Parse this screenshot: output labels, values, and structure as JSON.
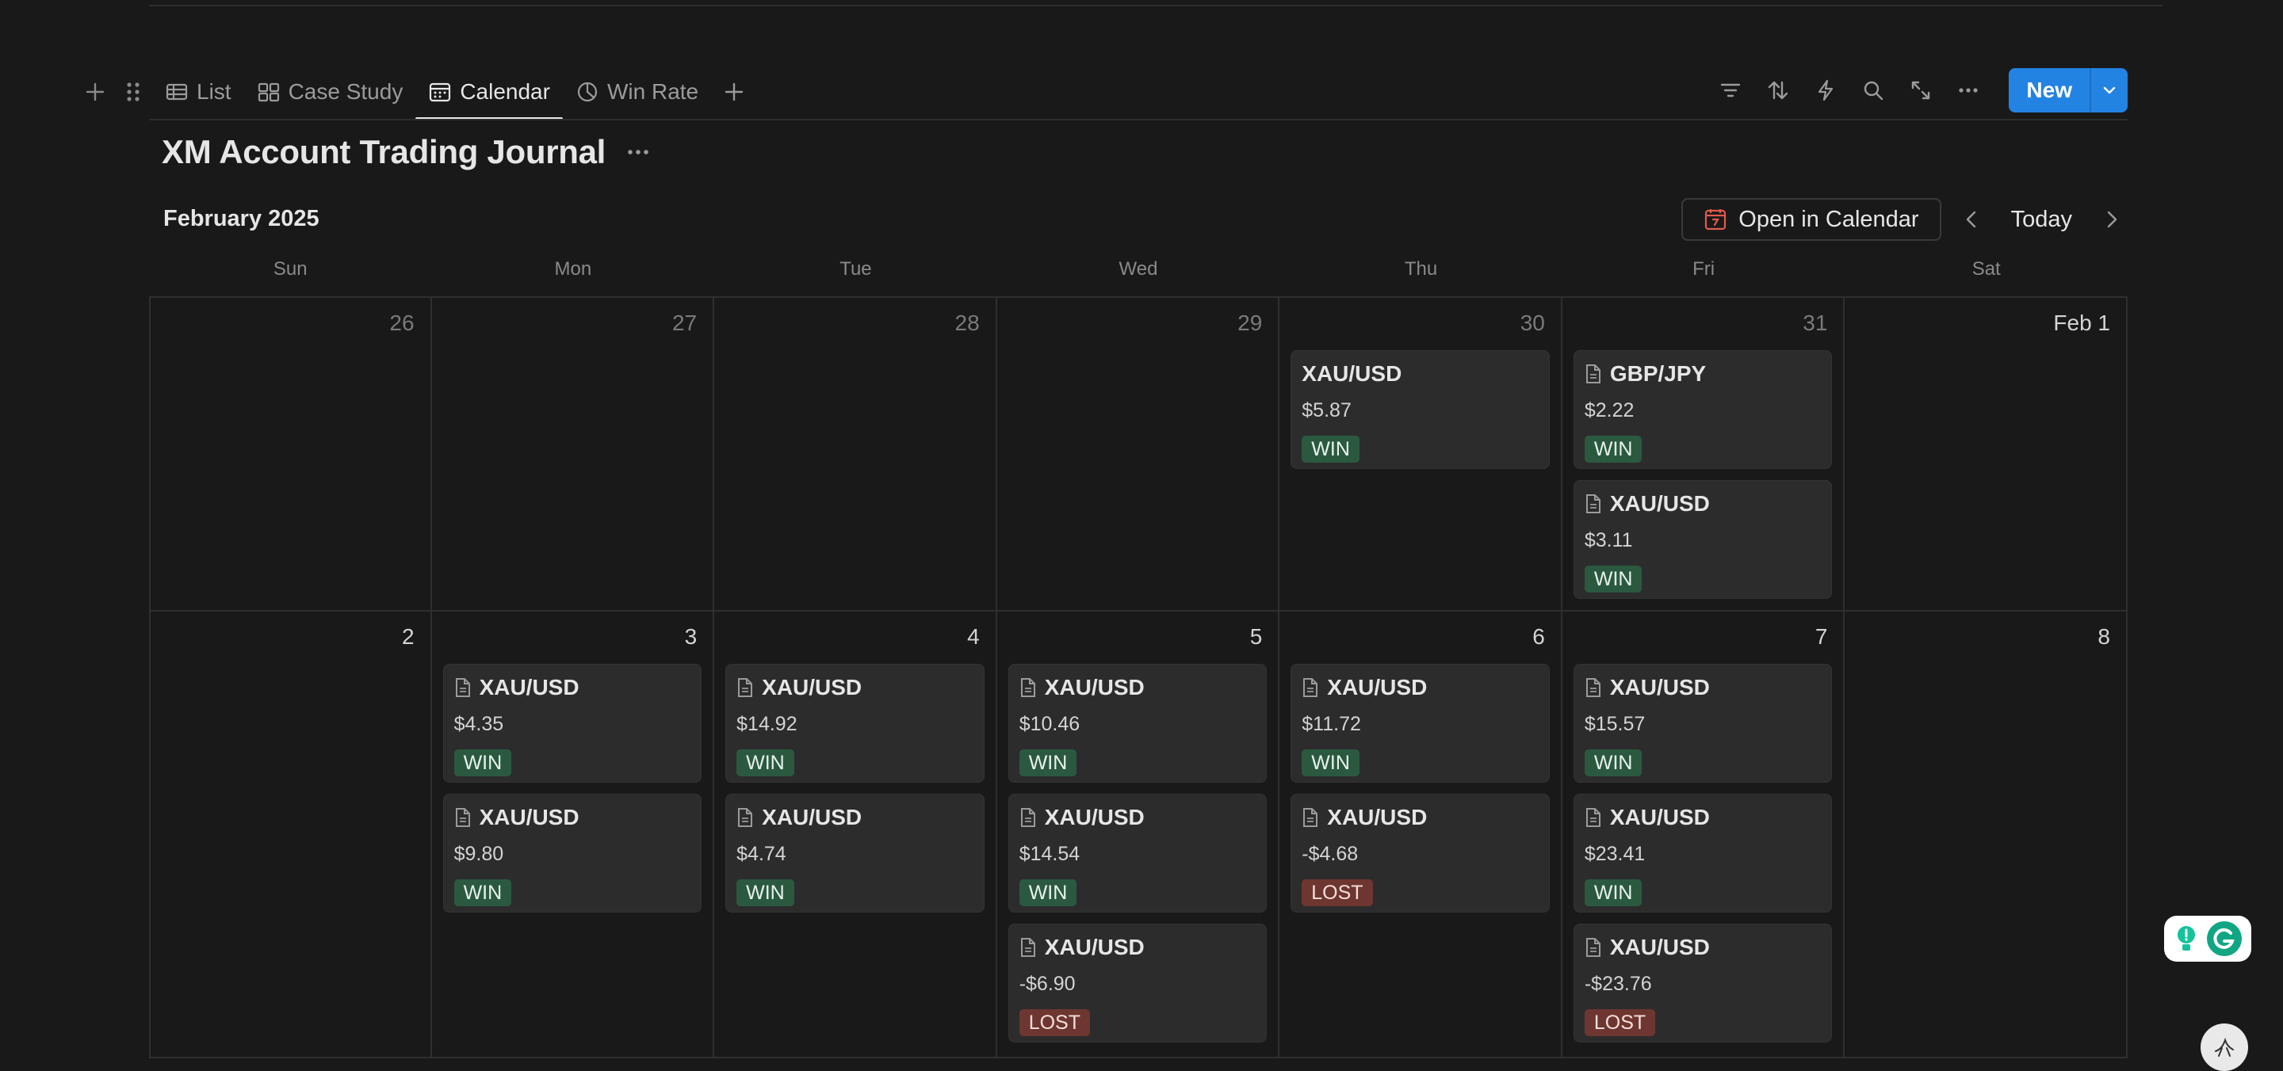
{
  "tabs": [
    {
      "label": "List",
      "icon": "table-icon",
      "active": false
    },
    {
      "label": "Case Study",
      "icon": "gallery-icon",
      "active": false
    },
    {
      "label": "Calendar",
      "icon": "calendar-icon",
      "active": true
    },
    {
      "label": "Win Rate",
      "icon": "pie-chart-icon",
      "active": false
    }
  ],
  "toolbar": {
    "new_label": "New"
  },
  "database": {
    "title": "XM Account Trading Journal"
  },
  "calendar": {
    "month_label": "February 2025",
    "open_label": "Open in Calendar",
    "today_label": "Today",
    "weekdays": [
      "Sun",
      "Mon",
      "Tue",
      "Wed",
      "Thu",
      "Fri",
      "Sat"
    ],
    "week1": {
      "days": [
        "26",
        "27",
        "28",
        "29",
        "30",
        "31",
        "Feb 1"
      ],
      "thu": [
        {
          "pair": "XAU/USD",
          "amount": "$5.87",
          "result": "WIN"
        }
      ],
      "fri": [
        {
          "pair": "GBP/JPY",
          "amount": "$2.22",
          "result": "WIN"
        },
        {
          "pair": "XAU/USD",
          "amount": "$3.11",
          "result": "WIN"
        }
      ]
    },
    "week2": {
      "days": [
        "2",
        "3",
        "4",
        "5",
        "6",
        "7",
        "8"
      ],
      "mon": [
        {
          "pair": "XAU/USD",
          "amount": "$4.35",
          "result": "WIN"
        },
        {
          "pair": "XAU/USD",
          "amount": "$9.80",
          "result": "WIN"
        }
      ],
      "tue": [
        {
          "pair": "XAU/USD",
          "amount": "$14.92",
          "result": "WIN"
        },
        {
          "pair": "XAU/USD",
          "amount": "$4.74",
          "result": "WIN"
        }
      ],
      "wed": [
        {
          "pair": "XAU/USD",
          "amount": "$10.46",
          "result": "WIN"
        },
        {
          "pair": "XAU/USD",
          "amount": "$14.54",
          "result": "WIN"
        },
        {
          "pair": "XAU/USD",
          "amount": "-$6.90",
          "result": "LOST"
        }
      ],
      "thu": [
        {
          "pair": "XAU/USD",
          "amount": "$11.72",
          "result": "WIN"
        },
        {
          "pair": "XAU/USD",
          "amount": "-$4.68",
          "result": "LOST"
        }
      ],
      "fri": [
        {
          "pair": "XAU/USD",
          "amount": "$15.57",
          "result": "WIN"
        },
        {
          "pair": "XAU/USD",
          "amount": "$23.41",
          "result": "WIN"
        },
        {
          "pair": "XAU/USD",
          "amount": "-$23.76",
          "result": "LOST"
        }
      ]
    }
  },
  "colors": {
    "accent": "#2383e2",
    "win_badge": "#2b593f",
    "lost_badge": "#6e3630",
    "background": "#191919",
    "card": "#2c2c2c"
  }
}
